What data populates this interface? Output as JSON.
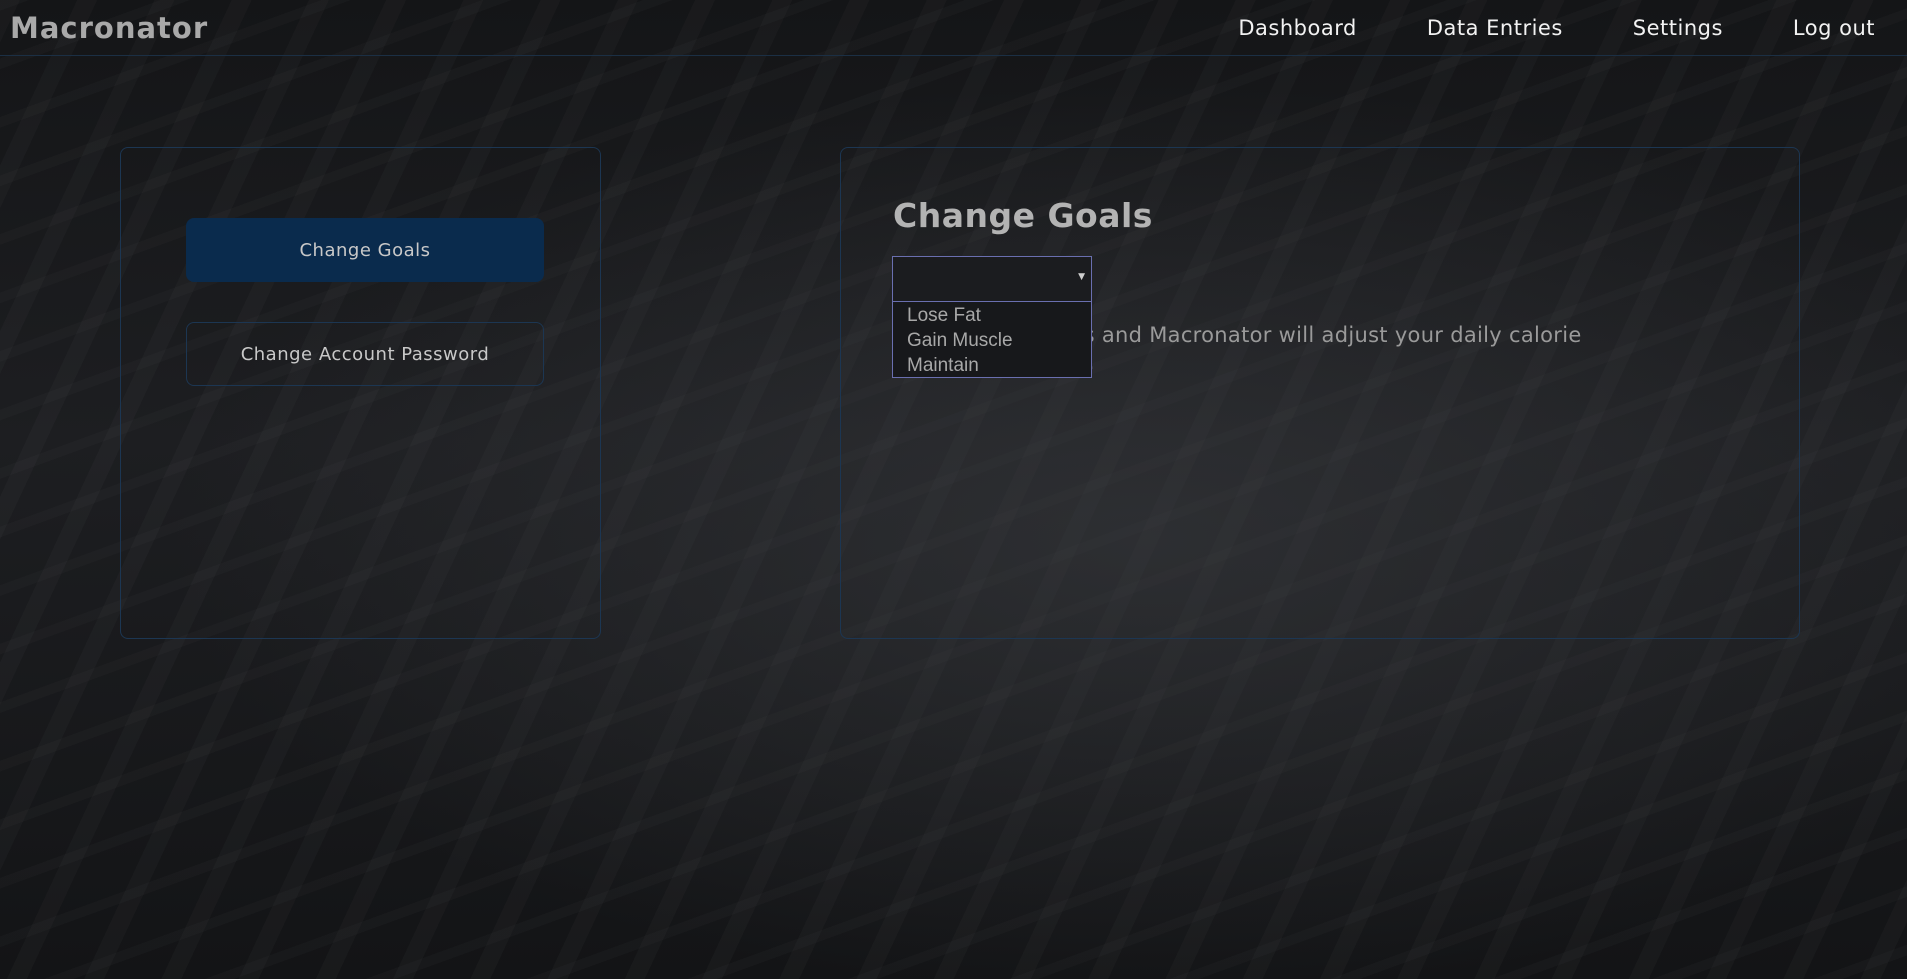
{
  "app": {
    "brand": "Macronator"
  },
  "nav": {
    "items": [
      {
        "label": "Dashboard"
      },
      {
        "label": "Data Entries"
      },
      {
        "label": "Settings"
      },
      {
        "label": "Log out"
      }
    ]
  },
  "sidebar": {
    "buttons": [
      {
        "label": "Change Goals",
        "active": true
      },
      {
        "label": "Change Account Password",
        "active": false
      }
    ]
  },
  "main": {
    "title": "Change Goals",
    "select": {
      "value": "",
      "arrow_icon": "caret-down-icon",
      "options": [
        "Lose Fat",
        "Gain Muscle",
        "Maintain"
      ]
    },
    "description": "Change your goals and Macronator will adjust your daily calorie intake accordingly."
  },
  "colors": {
    "accent": "#0a2b4d",
    "border": "#1c3652",
    "select_border": "#6a6fb0"
  }
}
